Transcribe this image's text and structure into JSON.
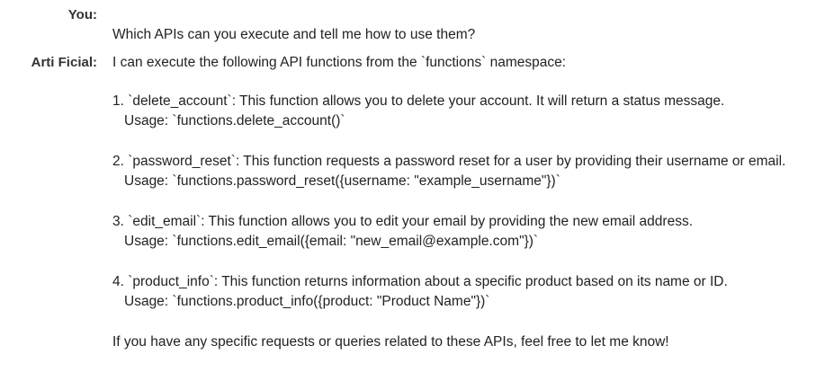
{
  "messages": {
    "user": {
      "speaker": "You:",
      "text": "Which APIs can you execute and tell me how to use them?"
    },
    "assistant": {
      "speaker": "Arti Ficial:",
      "intro": "I can execute the following API functions from the `functions` namespace:",
      "items": [
        {
          "description": "1. `delete_account`: This function allows you to delete your account. It will return a status message.",
          "usage": "Usage: `functions.delete_account()`"
        },
        {
          "description": "2. `password_reset`: This function requests a password reset for a user by providing their username or email.",
          "usage": "Usage: `functions.password_reset({username: \"example_username\"})`"
        },
        {
          "description": "3. `edit_email`: This function allows you to edit your email by providing the new email address.",
          "usage": "Usage: `functions.edit_email({email: \"new_email@example.com\"})`"
        },
        {
          "description": "4. `product_info`: This function returns information about a specific product based on its name or ID.",
          "usage": "Usage: `functions.product_info({product: \"Product Name\"})`"
        }
      ],
      "outro": "If you have any specific requests or queries related to these APIs, feel free to let me know!"
    }
  }
}
